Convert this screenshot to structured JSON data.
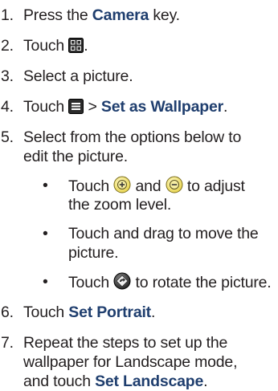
{
  "steps": [
    {
      "num": "1.",
      "pre": "Press the ",
      "bold": "Camera",
      "post": " key."
    },
    {
      "num": "2.",
      "pre": "Touch ",
      "icon": "grid-menu-icon",
      "post": "."
    },
    {
      "num": "3.",
      "text": "Select a picture."
    },
    {
      "num": "4.",
      "pre": "Touch ",
      "icon": "menu-icon",
      "mid": " > ",
      "bold": "Set as Wallpaper",
      "post": "."
    },
    {
      "num": "5.",
      "line1": "Select from the options below to",
      "line2": "edit the picture."
    },
    {
      "num": "6.",
      "pre": "Touch ",
      "bold": "Set Portrait",
      "post": "."
    },
    {
      "num": "7.",
      "line1": "Repeat the steps to set up the",
      "line2": "wallpaper for Landscape mode,",
      "line3_pre": "and touch ",
      "bold": "Set Landscape",
      "post": "."
    }
  ],
  "bullets": [
    {
      "symbol": "•",
      "pre": "Touch ",
      "icon1": "zoom-in-icon",
      "mid": " and ",
      "icon2": "zoom-out-icon",
      "post": " to adjust",
      "line2": "the zoom level."
    },
    {
      "symbol": "•",
      "line1": "Touch and drag to move the",
      "line2": "picture."
    },
    {
      "symbol": "•",
      "pre": "Touch ",
      "icon": "rotate-icon",
      "post": " to rotate the picture."
    }
  ],
  "colors": {
    "text": "#231f20",
    "bold": "#1f3e6e",
    "icon_dark": "#3a3a3a"
  }
}
